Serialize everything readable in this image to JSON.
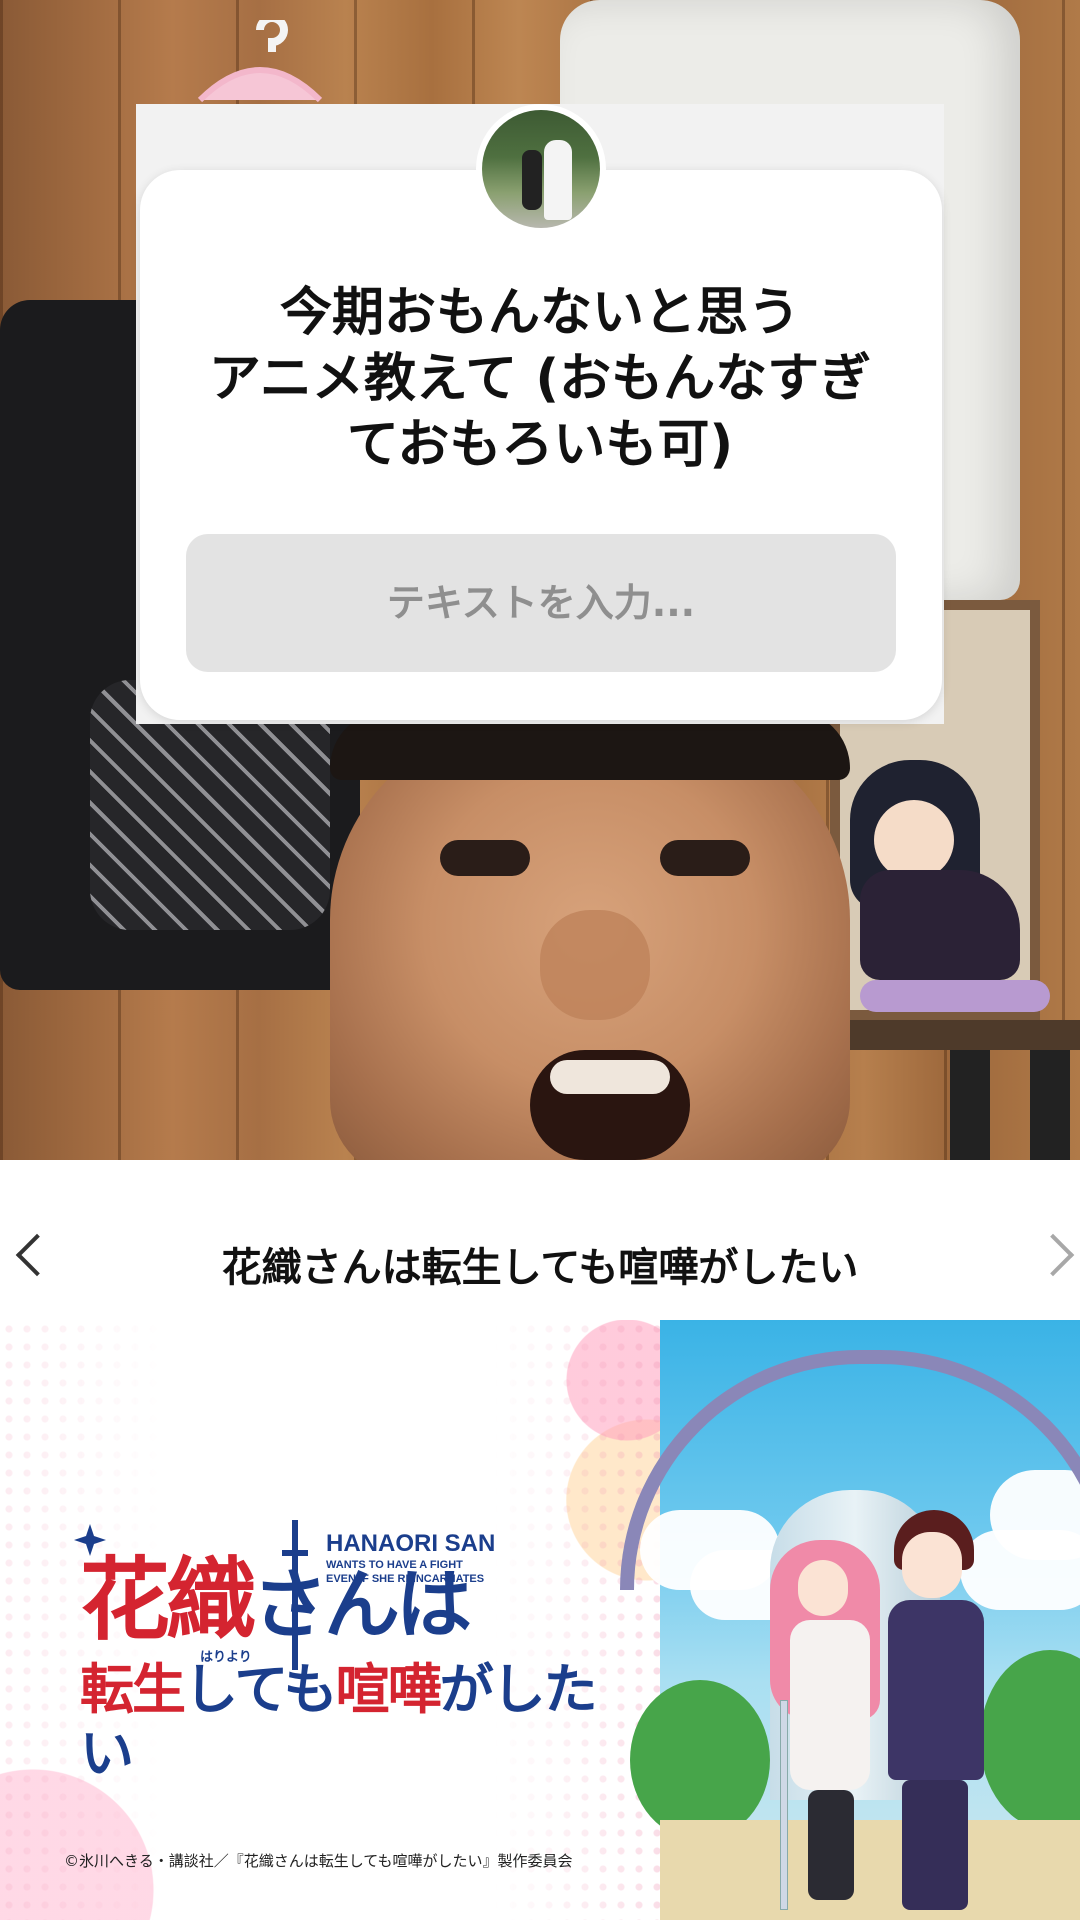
{
  "story": {
    "question_sticker": {
      "question": "今期おもんないと思う\nアニメ教えて (おもんなすぎ\nておもろいも可)",
      "input_placeholder": "テキストを入力..."
    }
  },
  "anime_card": {
    "title": "花織さんは転生しても喧嘩がしたい",
    "nav": {
      "prev_icon": "chevron-left-icon",
      "next_icon": "chevron-right-icon"
    },
    "key_visual": {
      "logo_line1_kanji": "花織",
      "logo_line1_kana": "さんは",
      "logo_line2_kanji_1": "転生",
      "logo_line2_kana_1": "しても",
      "logo_line2_kanji_2": "喧嘩",
      "logo_line2_kana_2": "がしたい",
      "logo_ruby": "はりより",
      "logo_en_line1": "HANAORI SAN",
      "logo_en_line2": "WANTS TO HAVE A FIGHT",
      "logo_en_line3": "EVEN IF SHE REINCARNATES",
      "copyright": "©氷川へきる・講談社／『花織さんは転生しても喧嘩がしたい』製作委員会"
    }
  },
  "colors": {
    "logo_red": "#d42430",
    "logo_blue": "#1b3e8c",
    "input_bg": "#e3e3e3",
    "placeholder": "#8f8f8f"
  }
}
